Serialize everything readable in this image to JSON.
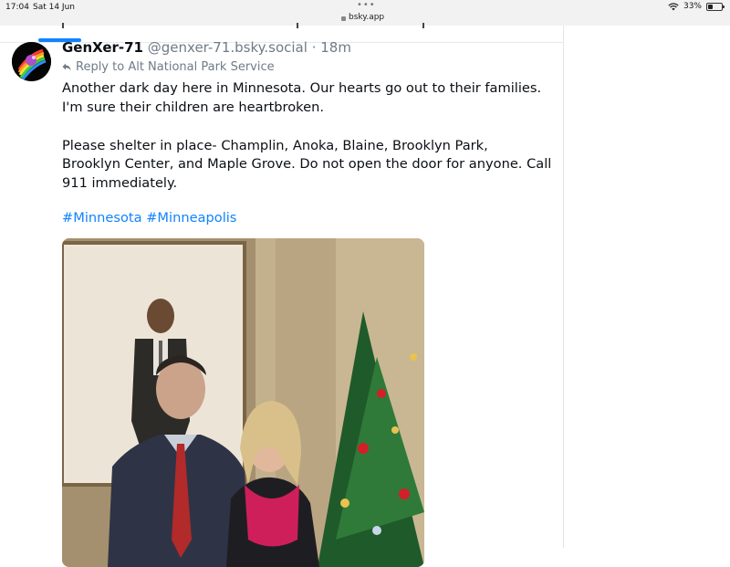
{
  "status_bar": {
    "time": "17:04",
    "date": "Sat 14 Jun",
    "url": "bsky.app",
    "battery": "33%",
    "battery_level": 0.33
  },
  "post": {
    "author": "GenXer-71",
    "handle": "@genxer-71.bsky.social",
    "separator": "·",
    "age": "18m",
    "reply_to": "Reply to Alt National Park Service",
    "text_lines": [
      "Another dark day here in Minnesota. Our hearts go out to their families.",
      "I'm sure their children are heartbroken.",
      "Please shelter in place- Champlin, Anoka, Blaine, Brooklyn Park,",
      "Brooklyn Center, and Maple Grove. Do not open the door for anyone. Call",
      "911 immediately."
    ],
    "hashtags": [
      "#Minnesota",
      "#Minneapolis"
    ]
  },
  "colors": {
    "accent": "#1083fe",
    "muted": "#6f7b88",
    "text": "#0b0f14"
  },
  "icons": {
    "reply": "reply-arrow-icon",
    "lock": "lock-icon",
    "wifi": "wifi-icon",
    "battery": "battery-icon"
  }
}
